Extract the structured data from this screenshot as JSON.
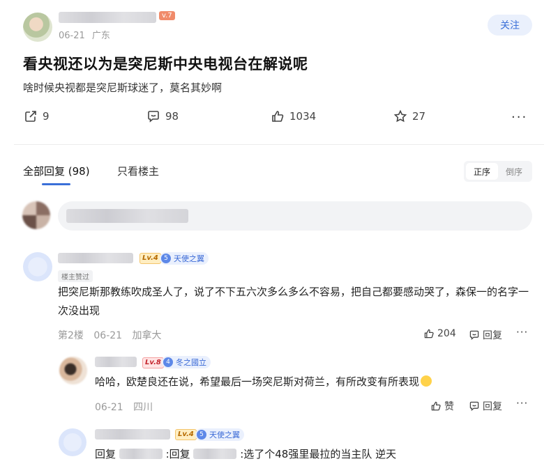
{
  "post": {
    "time": "06-21",
    "location": "广东",
    "follow_label": "关注",
    "title": "看央视还以为是突尼斯中央电视台在解说呢",
    "body": "啥时候央视都是突尼斯球迷了，莫名其妙啊",
    "level": "v.7",
    "actions": {
      "share_count": "9",
      "comment_count": "98",
      "like_count": "1034",
      "favorite_count": "27"
    }
  },
  "tabs": {
    "all_replies": "全部回复 (98)",
    "only_op": "只看楼主"
  },
  "sort": {
    "asc": "正序",
    "desc": "倒序"
  },
  "comments": [
    {
      "level": "Lv.4",
      "honor_level": "5",
      "honor": "天使之翼",
      "tag": "楼主赞过",
      "text": "把突尼斯那教练吹成圣人了，说了不下五六次多么多么不容易，把自己都要感动哭了，森保一的名字一次没出现",
      "floor": "第2楼",
      "time": "06-21",
      "location": "加拿大",
      "like_count": "204",
      "reply_label": "回复"
    }
  ],
  "replies": [
    {
      "level": "Lv.8",
      "honor_level": "4",
      "honor": "冬之國立",
      "text": "哈哈，欧楚良还在说，希望最后一场突尼斯对荷兰，有所改变有所表现",
      "time": "06-21",
      "location": "四川",
      "like_label": "赞",
      "reply_label": "回复"
    },
    {
      "level": "Lv.4",
      "honor_level": "5",
      "honor": "天使之翼",
      "prefix": "回复",
      "mid": ":回复",
      "text": ":选了个48强里最拉的当主队 逆天"
    }
  ]
}
